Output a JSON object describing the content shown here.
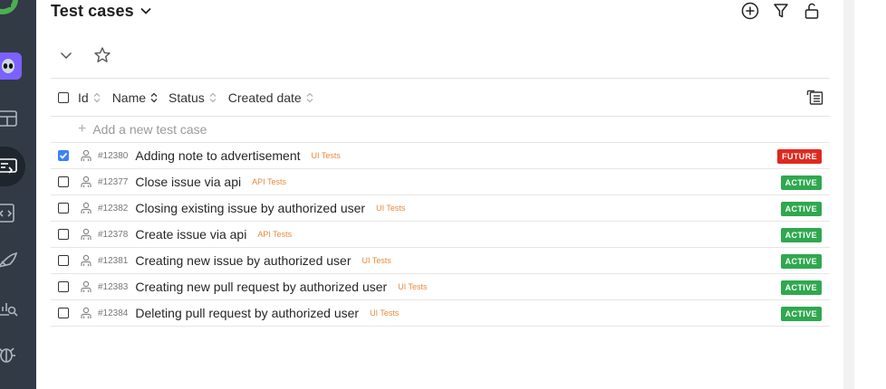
{
  "header": {
    "title": "Test cases"
  },
  "table": {
    "columns": {
      "id": "Id",
      "name": "Name",
      "status": "Status",
      "created": "Created date"
    },
    "add_placeholder": "Add a new test case",
    "rows": [
      {
        "id": "#12380",
        "name": "Adding note to advertisement",
        "tag": "UI Tests",
        "status": "FUTURE",
        "checked": true
      },
      {
        "id": "#12377",
        "name": "Close issue via api",
        "tag": "API Tests",
        "status": "ACTIVE",
        "checked": false
      },
      {
        "id": "#12382",
        "name": "Closing existing issue by authorized user",
        "tag": "UI Tests",
        "status": "ACTIVE",
        "checked": false
      },
      {
        "id": "#12378",
        "name": "Create issue via api",
        "tag": "API Tests",
        "status": "ACTIVE",
        "checked": false
      },
      {
        "id": "#12381",
        "name": "Creating new issue by authorized user",
        "tag": "UI Tests",
        "status": "ACTIVE",
        "checked": false
      },
      {
        "id": "#12383",
        "name": "Creating new pull request by authorized user",
        "tag": "UI Tests",
        "status": "ACTIVE",
        "checked": false
      },
      {
        "id": "#12384",
        "name": "Deleting pull request by authorized user",
        "tag": "UI Tests",
        "status": "ACTIVE",
        "checked": false
      }
    ]
  },
  "colors": {
    "rail": "#323a45",
    "logo": "#4caf50",
    "avatar": "#7b61ff",
    "status_active": "#2fa84f",
    "status_future": "#e0291f",
    "tag": "#e58a3d",
    "checkbox_checked": "#3b82f6"
  },
  "icons": {
    "logo": "allure-logo-icon",
    "avatar": "alien-avatar-icon",
    "nav": [
      "dashboard-icon",
      "test-cases-icon",
      "code-test-icon",
      "launch-rocket-icon",
      "analytics-search-icon",
      "bug-icon"
    ],
    "header": [
      "add-circle-icon",
      "filter-icon",
      "unlock-icon"
    ],
    "toolbar": [
      "collapse-chevron-icon",
      "star-icon"
    ],
    "columns": "column-settings-icon",
    "case": "manual-case-icon"
  }
}
